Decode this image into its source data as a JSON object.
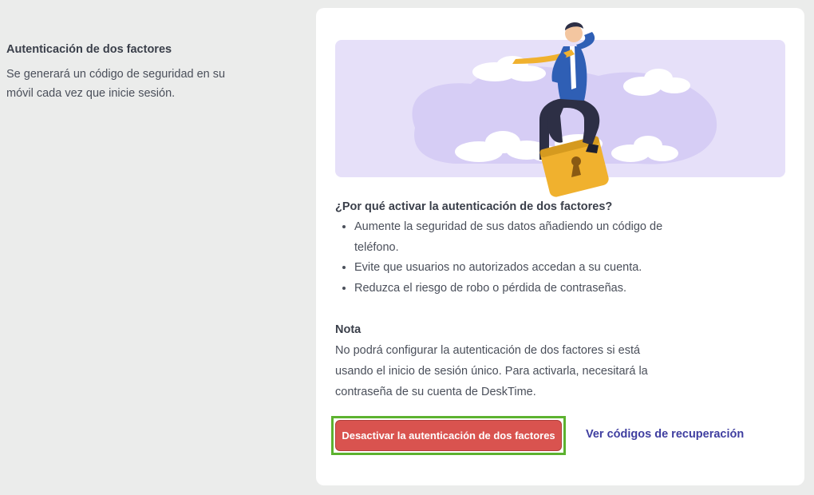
{
  "sidebar": {
    "title": "Autenticación de dos factores",
    "description": "Se generará un código de seguridad en su móvil cada vez que inicie sesión."
  },
  "card": {
    "why_title": "¿Por qué activar la autenticación de dos factores?",
    "benefits": [
      "Aumente la seguridad de sus datos añadiendo un código de teléfono.",
      "Evite que usuarios no autorizados accedan a su cuenta.",
      "Reduzca el riesgo de robo o pérdida de contraseñas."
    ],
    "note_title": "Nota",
    "note_text": "No podrá configurar la autenticación de dos factores si está usando el inicio de sesión único. Para activarla, necesitará la contraseña de su cuenta de DeskTime.",
    "deactivate_label": "Desactivar la autenticación de dos factores",
    "recovery_link": "Ver códigos de recuperación"
  },
  "colors": {
    "danger": "#d9534f",
    "highlight": "#5cb22f",
    "link": "#3f3ea0",
    "illustration_bg": "#e6e0f9"
  }
}
